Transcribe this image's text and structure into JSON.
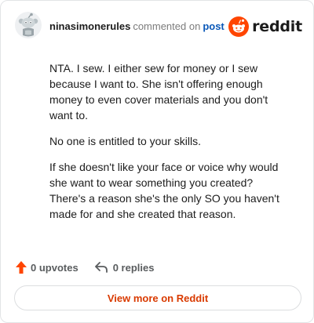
{
  "header": {
    "author": "ninasimonerules",
    "commented_text": "commented on",
    "post_link_text": "post",
    "brand_wordmark": "reddit"
  },
  "comment": {
    "paragraphs": [
      "NTA. I sew. I either sew for money or I sew because I want to. She isn't offering enough money to even cover materials and you don't want to.",
      "No one is entitled to your skills.",
      "If she doesn't like your face or voice why would she want to wear something you created? There's a reason she's the only SO you haven't made for and she created that reason."
    ]
  },
  "actions": {
    "upvotes_label": "0 upvotes",
    "replies_label": "0 replies"
  },
  "footer": {
    "view_more_label": "View more on Reddit"
  },
  "colors": {
    "accent": "#ff4500",
    "link": "#0a58b8",
    "view_more_text": "#d93a00",
    "muted": "#7c7c7c",
    "border": "#e2e4e6"
  },
  "icons": {
    "avatar": "snoo-avatar-icon",
    "brand": "reddit-logo-icon",
    "upvote": "upvote-arrow-icon",
    "reply": "reply-arrow-icon"
  }
}
